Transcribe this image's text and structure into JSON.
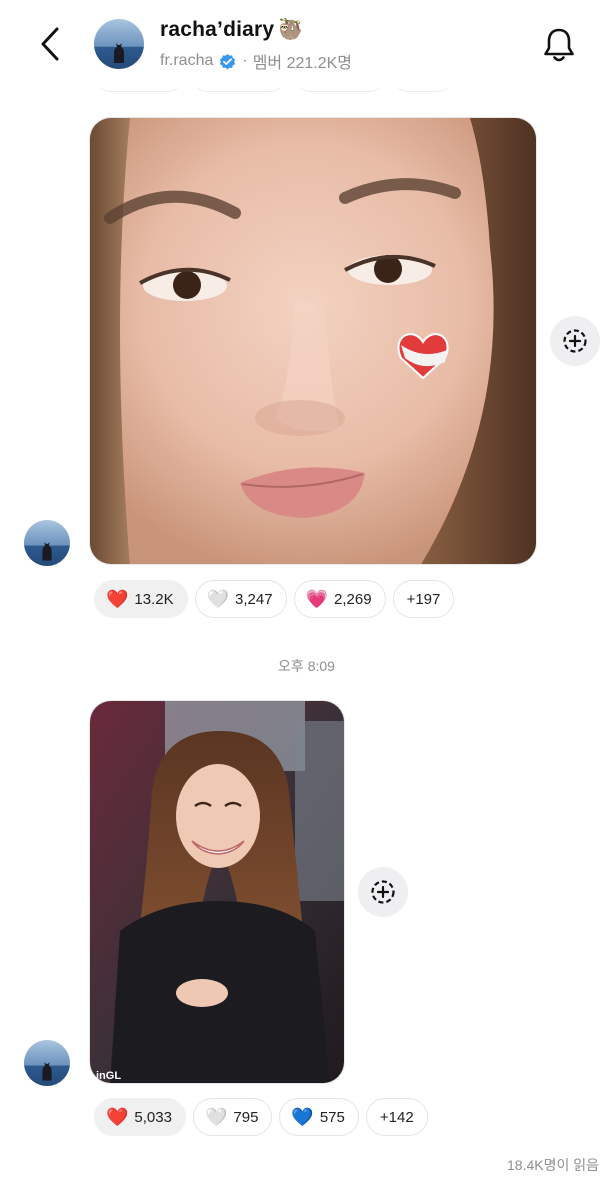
{
  "header": {
    "title": "racha’diary",
    "title_emoji": "🦥",
    "handle": "fr.racha",
    "separator": "·",
    "members": "멤버 221.2K명"
  },
  "messages": [
    {
      "reactions": [
        {
          "emoji": "❤️",
          "count": "13.2K",
          "active": true
        },
        {
          "emoji": "🤍",
          "count": "3,247"
        },
        {
          "emoji": "💗",
          "count": "2,269"
        },
        {
          "more": "+197"
        }
      ]
    },
    {
      "timestamp": "오후 8:09",
      "watermark": "inGL",
      "reactions": [
        {
          "emoji": "❤️",
          "count": "5,033",
          "active": true
        },
        {
          "emoji": "🤍",
          "count": "795"
        },
        {
          "emoji": "💙",
          "count": "575"
        },
        {
          "more": "+142"
        }
      ]
    }
  ],
  "footer": {
    "read_count": "18.4K명이 읽음"
  },
  "colors": {
    "verified": "#3897f0",
    "muted_text": "#8e8e93",
    "chip_border": "#e5e5e5"
  }
}
